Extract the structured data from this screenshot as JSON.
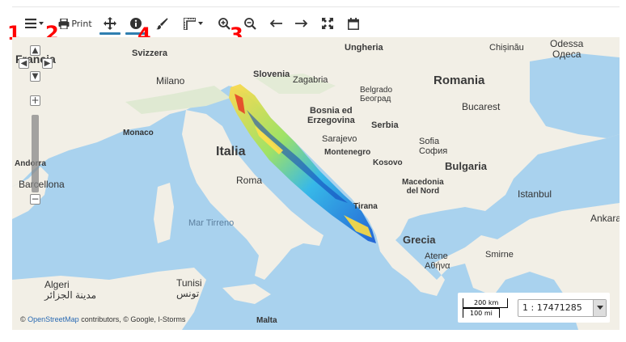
{
  "toolbar": {
    "menu_icon": "hamburger-menu-icon",
    "print_label": "Print",
    "tools": [
      "pan-icon",
      "info-icon",
      "brush-icon",
      "measure-icon",
      "zoom-in-icon",
      "zoom-out-icon",
      "back-icon",
      "forward-icon",
      "fullscreen-icon",
      "calendar-icon"
    ]
  },
  "annotations": {
    "one": "1",
    "two": "2",
    "three": "3",
    "four": "4"
  },
  "map": {
    "countries": {
      "francia": "Francia",
      "svizzera": "Svizzera",
      "slovenia": "Slovenia",
      "ungheria": "Ungheria",
      "romania": "Romania",
      "italia": "Italia",
      "bosnia": "Bosnia ed\nErzegovina",
      "serbia": "Serbia",
      "montenegro": "Montenegro",
      "kosovo": "Kosovo",
      "macedonia": "Macedonia\ndel Nord",
      "bulgaria": "Bulgaria",
      "grecia": "Grecia",
      "andorra": "Andorra"
    },
    "cities": {
      "odessa": "Odessa\nОдеса",
      "chisinau": "Chișinău",
      "milano": "Milano",
      "zagabria": "Zagabria",
      "belgrado": "Belgrado\nБеоград",
      "bucarest": "Bucarest",
      "monaco": "Monaco",
      "sarajevo": "Sarajevo",
      "roma": "Roma",
      "sofia": "Sofia\nСофия",
      "barcellona": "Barcellona",
      "istanbul": "Istanbul",
      "tirana": "Tirana",
      "ankara": "Ankara",
      "atene": "Atene\nΑθήνα",
      "smirne": "Smirne",
      "algeri": "Algeri\nمدينة الجزائر",
      "tunisi": "Tunisi\nتونس",
      "malta": "Malta"
    },
    "seas": {
      "mar_tirreno": "Mar Tirreno"
    },
    "attribution_prefix": "© ",
    "attribution_link": "OpenStreetMap",
    "attribution_rest": " contributors, © Google, I-Storms"
  },
  "zoom": {
    "pan_up": "▲",
    "pan_down": "▼",
    "pan_left": "◀",
    "pan_right": "▶",
    "plus": "+",
    "minus": "−"
  },
  "scale": {
    "km_label": "200 km",
    "mi_label": "100 mi",
    "value": "1 : 17471285"
  },
  "colors": {
    "sea": "#a9d2ee",
    "land": "#f2efe6",
    "accent": "#2f7fb0",
    "annotation": "#ff0000"
  }
}
